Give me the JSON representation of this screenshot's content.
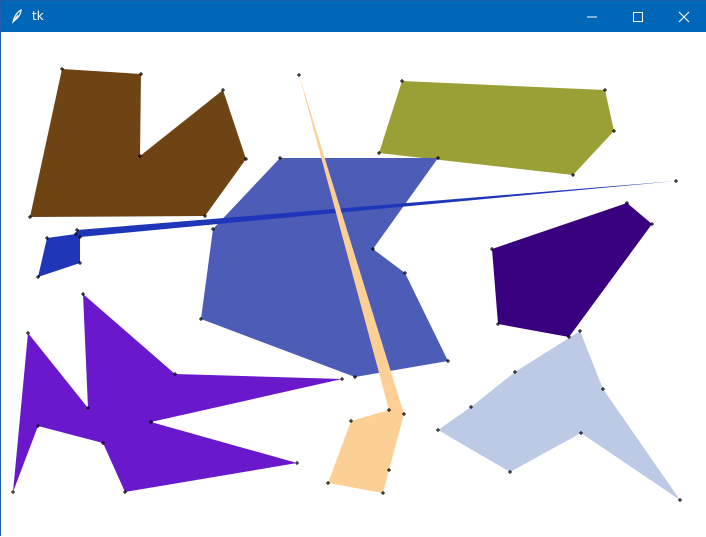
{
  "window": {
    "title": "tk",
    "icons": {
      "app": "feather-icon",
      "minimize": "minimize-icon",
      "maximize": "maximize-icon",
      "close": "close-icon"
    },
    "titlebar_color": "#0067b8"
  },
  "canvas": {
    "background": "#ffffff",
    "shape_colors": {
      "brown": "#6f4415",
      "olive": "#9aa035",
      "slate_blue": "#4d5cb6",
      "peach": "#fcd095",
      "royal_blue": "#1f36b8",
      "indigo": "#38007e",
      "violet": "#6a18cc",
      "light_steel_blue": "#bdcae6"
    },
    "vertex_marker": "+"
  }
}
